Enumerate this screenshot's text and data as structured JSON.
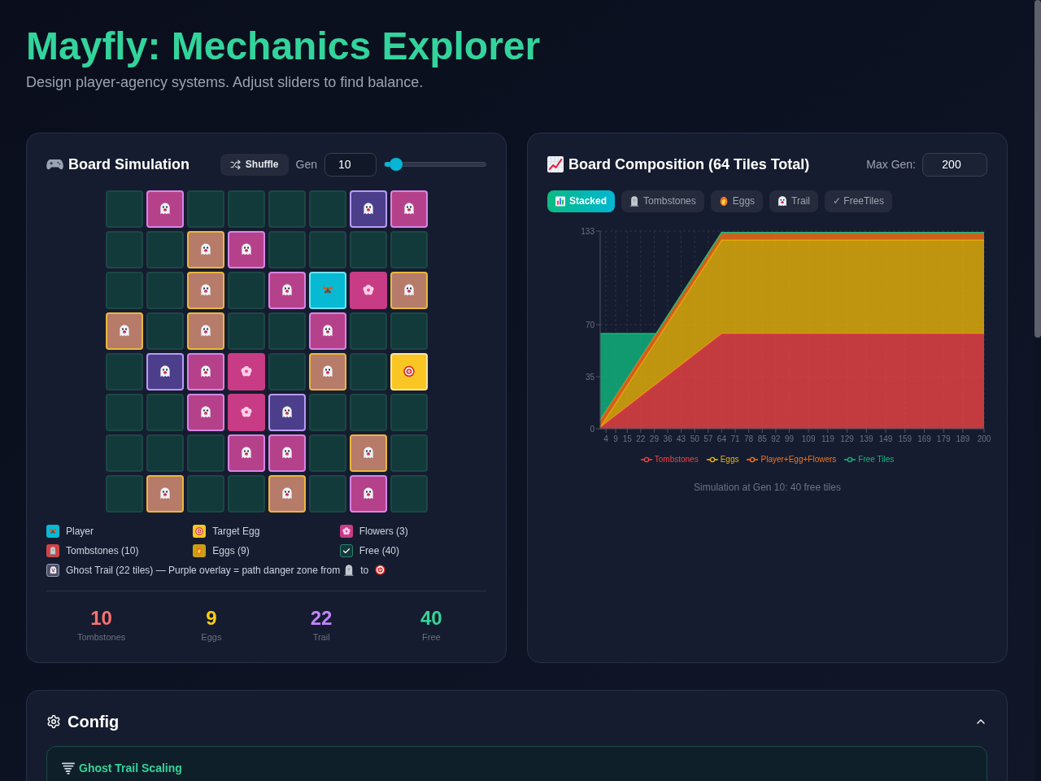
{
  "header": {
    "title": "Mayfly: Mechanics Explorer",
    "subtitle": "Design player-agency systems. Adjust sliders to find balance."
  },
  "board_panel": {
    "title": "Board Simulation",
    "shuffle_button": "Shuffle",
    "gen_label": "Gen",
    "gen_input": "10",
    "gen_slider": {
      "level": 0.05
    },
    "board": [
      [
        {
          "kind": "free",
          "trail": false
        },
        {
          "kind": "tombstone",
          "trail": true
        },
        {
          "kind": "free",
          "trail": false
        },
        {
          "kind": "free",
          "trail": false
        },
        {
          "kind": "free",
          "trail": false
        },
        {
          "kind": "free",
          "trail": false
        },
        {
          "kind": "free",
          "trail": true
        },
        {
          "kind": "tombstone",
          "trail": true
        }
      ],
      [
        {
          "kind": "free",
          "trail": false
        },
        {
          "kind": "free",
          "trail": false
        },
        {
          "kind": "egg",
          "trail": true
        },
        {
          "kind": "tombstone",
          "trail": true
        },
        {
          "kind": "free",
          "trail": false
        },
        {
          "kind": "free",
          "trail": false
        },
        {
          "kind": "free",
          "trail": false
        },
        {
          "kind": "free",
          "trail": false
        }
      ],
      [
        {
          "kind": "free",
          "trail": false
        },
        {
          "kind": "free",
          "trail": false
        },
        {
          "kind": "egg",
          "trail": true
        },
        {
          "kind": "free",
          "trail": false
        },
        {
          "kind": "tombstone",
          "trail": true
        },
        {
          "kind": "player",
          "trail": false
        },
        {
          "kind": "flower",
          "trail": false
        },
        {
          "kind": "egg",
          "trail": true
        }
      ],
      [
        {
          "kind": "egg",
          "trail": true
        },
        {
          "kind": "free",
          "trail": false
        },
        {
          "kind": "egg",
          "trail": true
        },
        {
          "kind": "free",
          "trail": false
        },
        {
          "kind": "free",
          "trail": false
        },
        {
          "kind": "tombstone",
          "trail": true
        },
        {
          "kind": "free",
          "trail": false
        },
        {
          "kind": "free",
          "trail": false
        }
      ],
      [
        {
          "kind": "free",
          "trail": false
        },
        {
          "kind": "free",
          "trail": true
        },
        {
          "kind": "tombstone",
          "trail": true
        },
        {
          "kind": "flower",
          "trail": false
        },
        {
          "kind": "free",
          "trail": false
        },
        {
          "kind": "egg",
          "trail": true
        },
        {
          "kind": "free",
          "trail": false
        },
        {
          "kind": "target",
          "trail": false
        }
      ],
      [
        {
          "kind": "free",
          "trail": false
        },
        {
          "kind": "free",
          "trail": false
        },
        {
          "kind": "tombstone",
          "trail": true
        },
        {
          "kind": "flower",
          "trail": false
        },
        {
          "kind": "free",
          "trail": true
        },
        {
          "kind": "free",
          "trail": false
        },
        {
          "kind": "free",
          "trail": false
        },
        {
          "kind": "free",
          "trail": false
        }
      ],
      [
        {
          "kind": "free",
          "trail": false
        },
        {
          "kind": "free",
          "trail": false
        },
        {
          "kind": "free",
          "trail": false
        },
        {
          "kind": "tombstone",
          "trail": true
        },
        {
          "kind": "tombstone",
          "trail": true
        },
        {
          "kind": "free",
          "trail": false
        },
        {
          "kind": "egg",
          "trail": true
        },
        {
          "kind": "free",
          "trail": false
        }
      ],
      [
        {
          "kind": "free",
          "trail": false
        },
        {
          "kind": "egg",
          "trail": true
        },
        {
          "kind": "free",
          "trail": false
        },
        {
          "kind": "free",
          "trail": false
        },
        {
          "kind": "egg",
          "trail": true
        },
        {
          "kind": "free",
          "trail": false
        },
        {
          "kind": "tombstone",
          "trail": true
        },
        {
          "kind": "free",
          "trail": false
        }
      ]
    ],
    "legend": [
      {
        "kind": "player",
        "label": "Player",
        "color": "#08b9d4"
      },
      {
        "kind": "target",
        "label": "Target Egg",
        "color": "#fac623"
      },
      {
        "kind": "flower",
        "label": "Flowers (3)",
        "color": "#c83c86"
      },
      {
        "kind": "tombstone",
        "label": "Tombstones (10)",
        "color": "#d14343"
      },
      {
        "kind": "egg",
        "label": "Eggs (9)",
        "color": "#c9a014"
      },
      {
        "kind": "free",
        "label": "Free (40)",
        "color": "#133a3b"
      }
    ],
    "trail_note": {
      "text": "Ghost Trail (22 tiles) — Purple overlay = path danger zone from",
      "joiner": "to"
    },
    "stats": [
      {
        "value": "10",
        "label": "Tombstones",
        "color": "#f87171"
      },
      {
        "value": "9",
        "label": "Eggs",
        "color": "#facc15"
      },
      {
        "value": "22",
        "label": "Trail",
        "color": "#c084fc"
      },
      {
        "value": "40",
        "label": "Free",
        "color": "#34d399"
      }
    ]
  },
  "chart_panel": {
    "title": "Board Composition (64 Tiles Total)",
    "max_gen_label": "Max Gen:",
    "max_gen_input": "200",
    "tabs": [
      {
        "label": "Stacked",
        "kind": "chart",
        "selected": true
      },
      {
        "label": "Tombstones",
        "kind": "tombstone",
        "selected": false
      },
      {
        "label": "Eggs",
        "kind": "egg",
        "selected": false
      },
      {
        "label": "Trail",
        "kind": "ghost",
        "selected": false
      },
      {
        "label": "✓ FreeTiles",
        "kind": "plain",
        "selected": false
      }
    ],
    "chart_data": {
      "type": "area",
      "stacked": true,
      "x": [
        1,
        30,
        64,
        200
      ],
      "xlim": [
        1,
        200
      ],
      "ylim": [
        0,
        133
      ],
      "xticks": [
        4,
        9,
        15,
        22,
        29,
        36,
        43,
        50,
        57,
        64,
        71,
        78,
        85,
        92,
        99,
        109,
        119,
        129,
        139,
        149,
        159,
        169,
        179,
        189,
        200
      ],
      "yticks": [
        0,
        35,
        70,
        133
      ],
      "grid": true,
      "legend": "bottom",
      "series": [
        {
          "name": "Tombstones",
          "color": "#ef4444",
          "values": [
            1,
            30,
            64,
            64
          ]
        },
        {
          "name": "Eggs",
          "color": "#eab308",
          "values": [
            0,
            29,
            63,
            63
          ]
        },
        {
          "name": "Player+Egg+Flowers",
          "color": "#f97316",
          "values": [
            5,
            5,
            5,
            5
          ]
        },
        {
          "name": "Free Tiles",
          "color": "#10b981",
          "values": [
            58,
            0,
            0,
            0
          ]
        }
      ]
    },
    "caption": "Simulation at Gen 10: 40 free tiles"
  },
  "config": {
    "title": "Config",
    "expanded": true,
    "sections": [
      {
        "title": "Ghost Trail Scaling"
      }
    ]
  }
}
